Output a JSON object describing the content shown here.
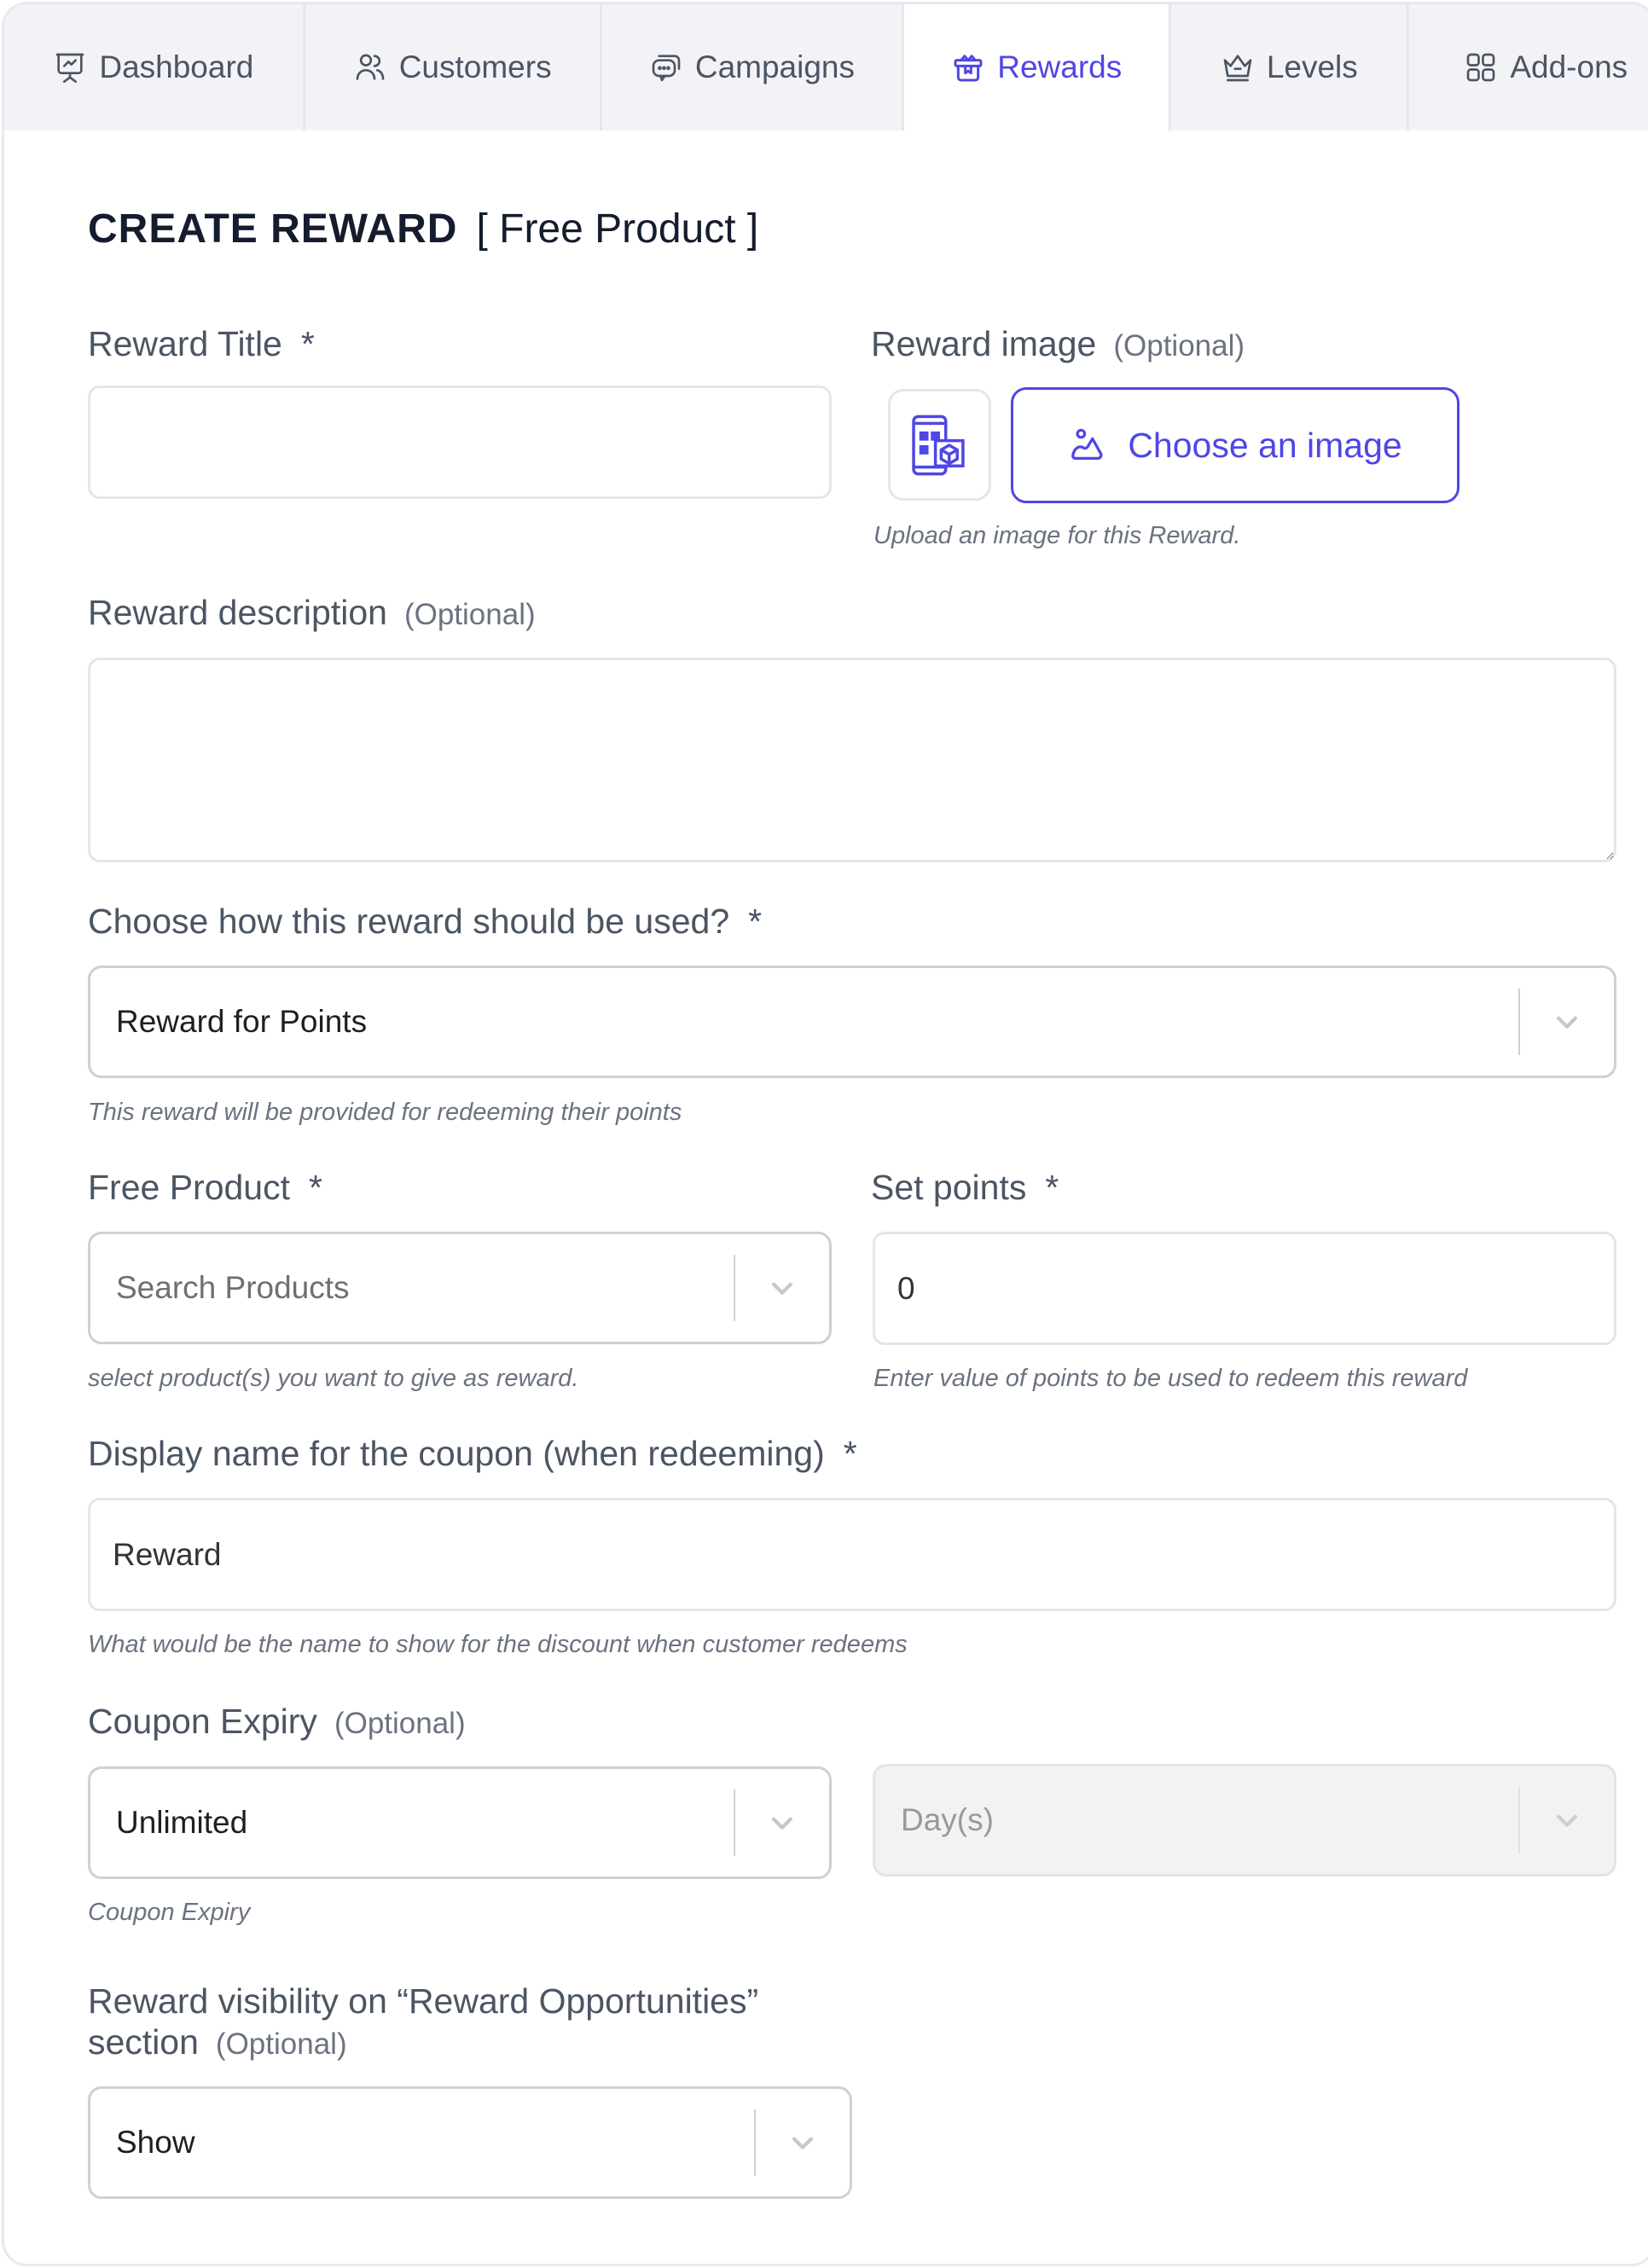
{
  "tabs": [
    {
      "label": "Dashboard",
      "icon": "presentation-chart-icon",
      "active": false
    },
    {
      "label": "Customers",
      "icon": "users-icon",
      "active": false
    },
    {
      "label": "Campaigns",
      "icon": "chat-bubbles-icon",
      "active": false
    },
    {
      "label": "Rewards",
      "icon": "gift-box-icon",
      "active": true
    },
    {
      "label": "Levels",
      "icon": "crown-icon",
      "active": false
    },
    {
      "label": "Add-ons",
      "icon": "grid-icon",
      "active": false
    }
  ],
  "page": {
    "title": "CREATE REWARD",
    "subtitle": "[ Free Product ]"
  },
  "form": {
    "reward_title": {
      "label": "Reward Title",
      "required_mark": "*",
      "value": ""
    },
    "reward_image": {
      "label": "Reward image",
      "optional": "(Optional)",
      "button_label": "Choose an image",
      "help": "Upload an image for this Reward."
    },
    "reward_description": {
      "label": "Reward description",
      "optional": "(Optional)",
      "value": ""
    },
    "usage": {
      "label": "Choose how this reward should be used?",
      "required_mark": "*",
      "selected": "Reward for Points",
      "help": "This reward will be provided for redeeming their points"
    },
    "free_product": {
      "label": "Free Product",
      "required_mark": "*",
      "placeholder": "Search Products",
      "help": "select product(s) you want to give as reward."
    },
    "set_points": {
      "label": "Set points",
      "required_mark": "*",
      "value": "0",
      "help": "Enter value of points to be used to redeem this reward"
    },
    "coupon_display_name": {
      "label": "Display name for the coupon (when redeeming)",
      "required_mark": "*",
      "value": "Reward",
      "help": "What would be the name to show for the discount when customer redeems"
    },
    "coupon_expiry": {
      "label": "Coupon Expiry",
      "optional": "(Optional)",
      "selected": "Unlimited",
      "unit_selected": "Day(s)",
      "help": "Coupon Expiry"
    },
    "visibility": {
      "label_line1": "Reward visibility on “Reward Opportunities”",
      "label_line2": "section",
      "optional": "(Optional)",
      "selected": "Show"
    }
  },
  "colors": {
    "accent": "#4f46e5",
    "title": "#141c2e",
    "label": "#4b5563",
    "help": "#6b7280",
    "tab_bg": "#f3f3f7"
  }
}
